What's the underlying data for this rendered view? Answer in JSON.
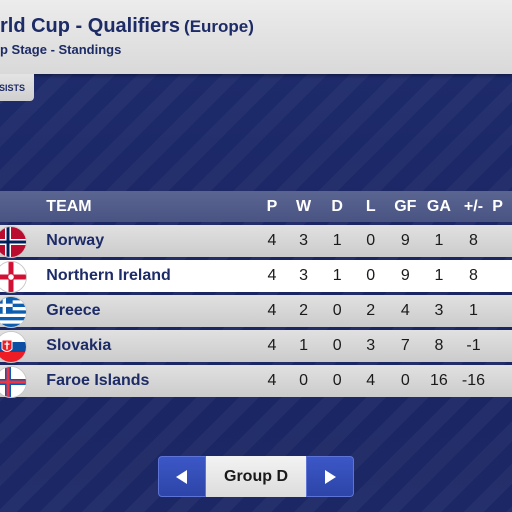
{
  "header": {
    "title": "rld Cup - Qualifiers",
    "region": "(Europe)",
    "subtitle": "p Stage - Standings"
  },
  "tab": {
    "label": "SISTS"
  },
  "table": {
    "columns": [
      "TEAM",
      "P",
      "W",
      "D",
      "L",
      "GF",
      "GA",
      "+/-",
      "P"
    ],
    "rows": [
      {
        "team": "Norway",
        "flag": "norway-flag-icon",
        "p": "4",
        "w": "3",
        "d": "1",
        "l": "0",
        "gf": "9",
        "ga": "1",
        "pm": "8",
        "highlight": false
      },
      {
        "team": "Northern Ireland",
        "flag": "northern-ireland-flag-icon",
        "p": "4",
        "w": "3",
        "d": "1",
        "l": "0",
        "gf": "9",
        "ga": "1",
        "pm": "8",
        "highlight": true
      },
      {
        "team": "Greece",
        "flag": "greece-flag-icon",
        "p": "4",
        "w": "2",
        "d": "0",
        "l": "2",
        "gf": "4",
        "ga": "3",
        "pm": "1",
        "highlight": false
      },
      {
        "team": "Slovakia",
        "flag": "slovakia-flag-icon",
        "p": "4",
        "w": "1",
        "d": "0",
        "l": "3",
        "gf": "7",
        "ga": "8",
        "pm": "-1",
        "highlight": false
      },
      {
        "team": "Faroe Islands",
        "flag": "faroe-islands-flag-icon",
        "p": "4",
        "w": "0",
        "d": "0",
        "l": "4",
        "gf": "0",
        "ga": "16",
        "pm": "-16",
        "highlight": false
      }
    ]
  },
  "nav": {
    "group_label": "Group D",
    "prev_icon": "chevron-left-icon",
    "next_icon": "chevron-right-icon"
  },
  "colors": {
    "background": "#1f2d6e",
    "header_text": "#1d2b66",
    "table_head": "#4f598a",
    "nav_button": "#3550bb"
  }
}
